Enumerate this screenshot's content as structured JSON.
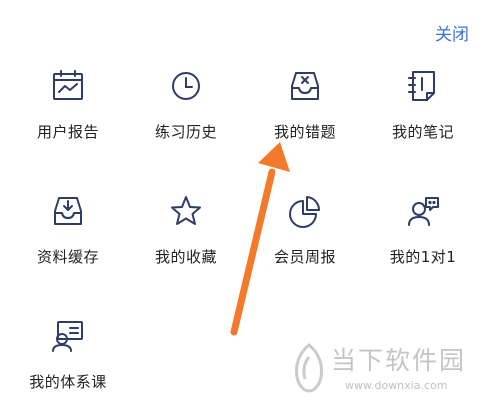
{
  "header": {
    "close_label": "关闭"
  },
  "menu": {
    "items": [
      {
        "label": "用户报告"
      },
      {
        "label": "练习历史"
      },
      {
        "label": "我的错题"
      },
      {
        "label": "我的笔记"
      },
      {
        "label": "资料缓存"
      },
      {
        "label": "我的收藏"
      },
      {
        "label": "会员周报"
      },
      {
        "label": "我的1对1"
      },
      {
        "label": "我的体系课"
      }
    ]
  },
  "watermark": {
    "title": "当下软件园",
    "url": "www.downxia.com"
  },
  "colors": {
    "icon": "#2f3d66",
    "accent": "#3b72d9",
    "arrow": "#f47a2b",
    "text": "#222222"
  }
}
